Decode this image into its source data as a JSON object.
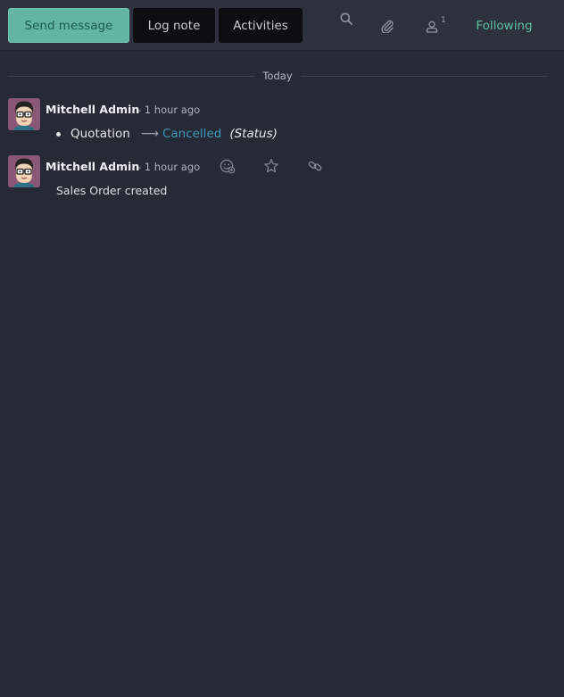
{
  "composer": {
    "send_message_label": "Send message",
    "log_note_label": "Log note",
    "activities_label": "Activities"
  },
  "tools": {
    "followers_count": "1",
    "following_label": "Following"
  },
  "thread": {
    "date_separator": "Today",
    "messages": [
      {
        "author": "Mitchell Admin",
        "date": "- 1 hour ago",
        "tracking": {
          "old_value": "Quotation",
          "new_value": "Cancelled",
          "field": "(Status)"
        }
      },
      {
        "author": "Mitchell Admin",
        "date": "- 1 hour ago",
        "body": "Sales Order created"
      }
    ]
  },
  "colors": {
    "background": "#262a36",
    "topbar": "#2d313e",
    "primary_button": "#63b5a2",
    "following": "#5fbf9f",
    "tracking_new_value": "#3c98b8"
  }
}
